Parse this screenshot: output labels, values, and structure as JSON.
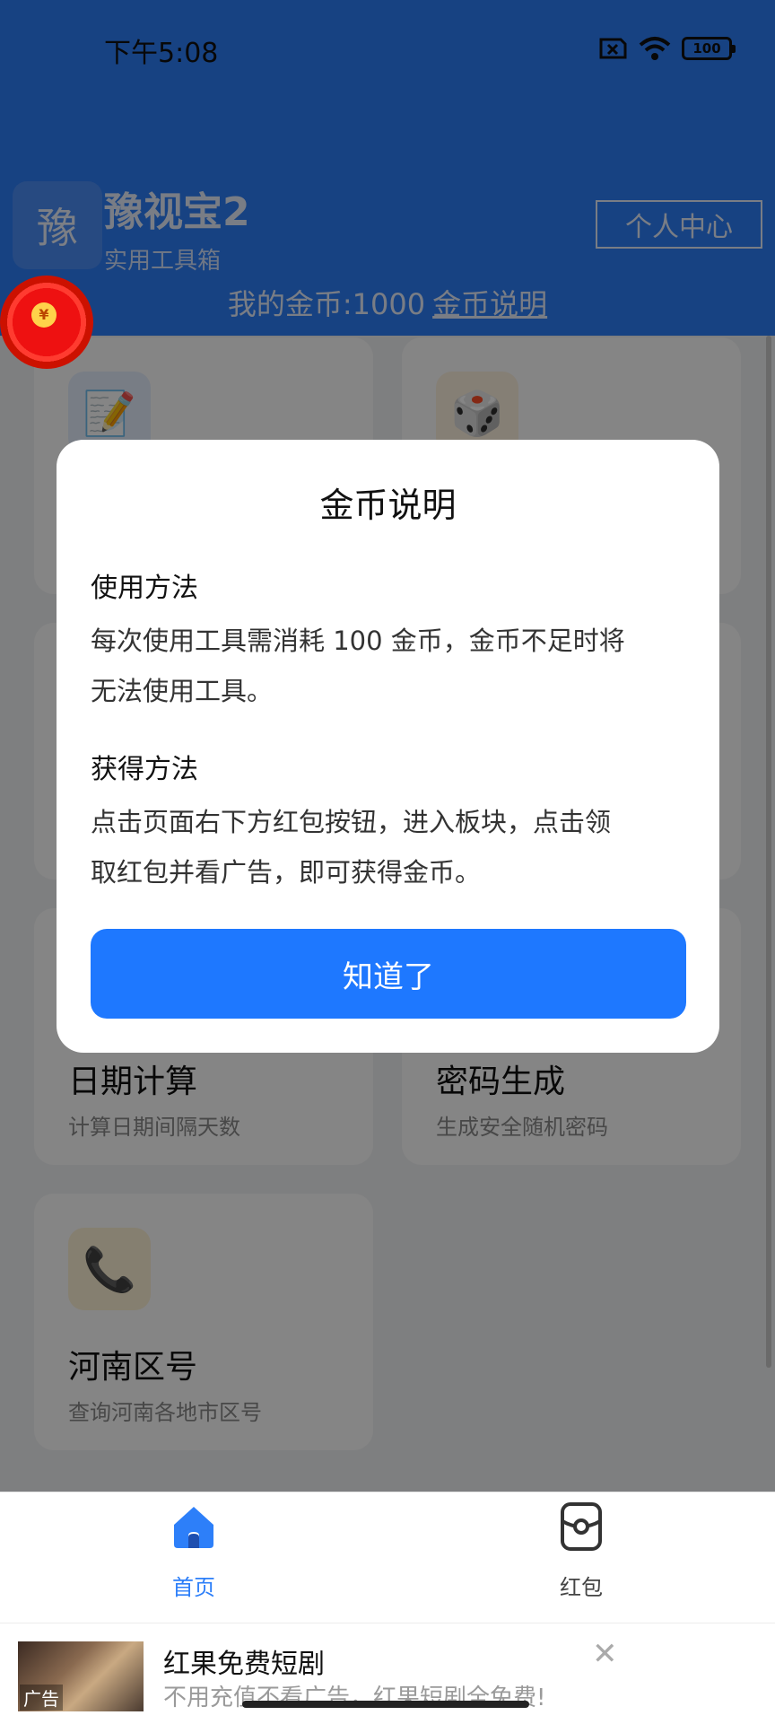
{
  "status": {
    "time": "下午5:08",
    "battery": "100"
  },
  "header": {
    "logo_char": "豫",
    "title": "豫视宝2",
    "subtitle": "实用工具箱",
    "personal_center": "个人中心",
    "coins_text": "我的金币:1000",
    "coins_link": "金币说明"
  },
  "cards": [
    {
      "icon": "📝",
      "title": "",
      "desc": ""
    },
    {
      "icon": "🎲",
      "title": "",
      "desc": ""
    },
    {
      "icon": "",
      "title": "日期计算",
      "desc": "计算日期间隔天数"
    },
    {
      "icon": "",
      "title": "密码生成",
      "desc": "生成安全随机密码"
    },
    {
      "icon": "📞",
      "title": "河南区号",
      "desc": "查询河南各地市区号"
    }
  ],
  "dialog": {
    "title": "金币说明",
    "section1_title": "使用方法",
    "section1_line1": "每次使用工具需消耗 100 金币，金币不足时将",
    "section1_line2": "无法使用工具。",
    "section2_title": "获得方法",
    "section2_line1": "点击页面右下方红包按钮，进入板块，点击领",
    "section2_line2": "取红包并看广告，即可获得金币。",
    "ok_label": "知道了"
  },
  "nav": {
    "home_label": "首页",
    "redpacket_label": "红包",
    "active_color": "#2d7ff9"
  },
  "ad": {
    "tag": "广告",
    "title": "红果免费短剧",
    "subtitle": "不用充值不看广告，红果短剧全免费!",
    "close": "✕"
  }
}
